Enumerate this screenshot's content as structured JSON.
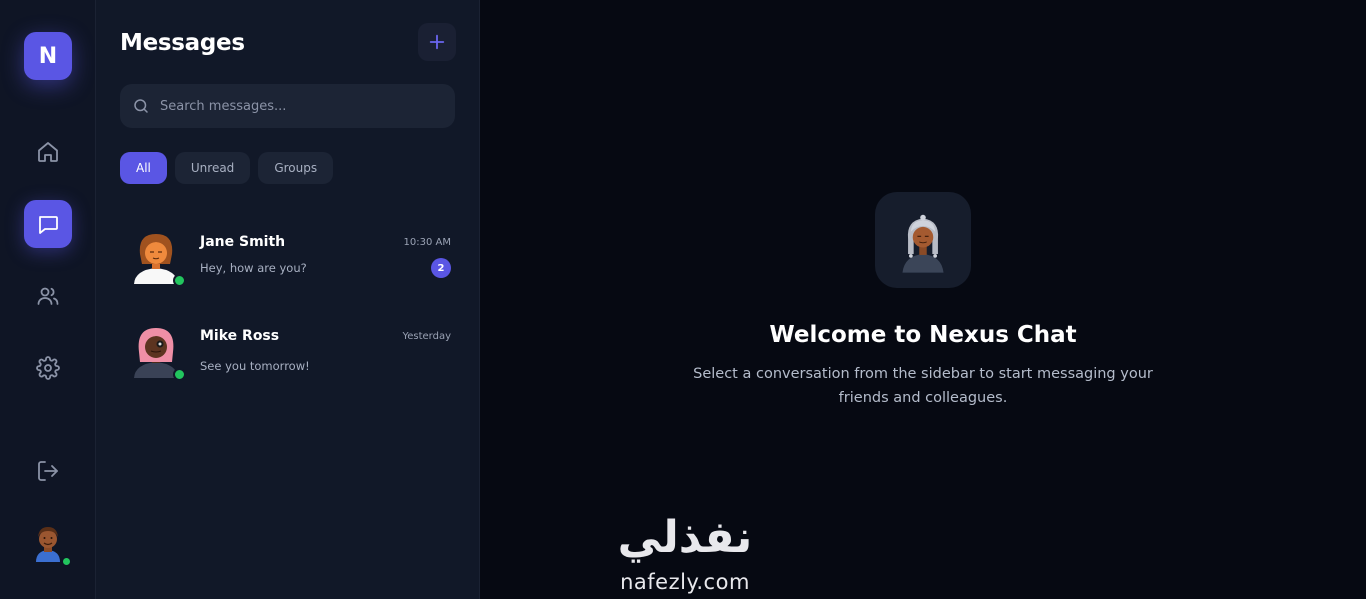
{
  "app": {
    "logo_letter": "N"
  },
  "panel": {
    "title": "Messages",
    "search_placeholder": "Search messages...",
    "filters": [
      {
        "label": "All",
        "active": true
      },
      {
        "label": "Unread",
        "active": false
      },
      {
        "label": "Groups",
        "active": false
      }
    ],
    "conversations": [
      {
        "name": "Jane Smith",
        "time": "10:30 AM",
        "preview": "Hey, how are you?",
        "unread": "2",
        "online": true
      },
      {
        "name": "Mike Ross",
        "time": "Yesterday",
        "preview": "See you tomorrow!",
        "unread": "",
        "online": true
      }
    ]
  },
  "main": {
    "welcome_title": "Welcome to Nexus Chat",
    "welcome_subtitle": "Select a conversation from the sidebar to start messaging your friends and colleagues."
  },
  "watermark": {
    "arabic": "نفذلي",
    "latin": "nafezly.com"
  },
  "colors": {
    "accent": "#5a56e4",
    "online": "#22c55e",
    "bg": "#060912",
    "panel": "#111828"
  },
  "icons": [
    "home-icon",
    "chat-icon",
    "users-icon",
    "settings-icon",
    "logout-icon",
    "plus-icon",
    "search-icon"
  ]
}
